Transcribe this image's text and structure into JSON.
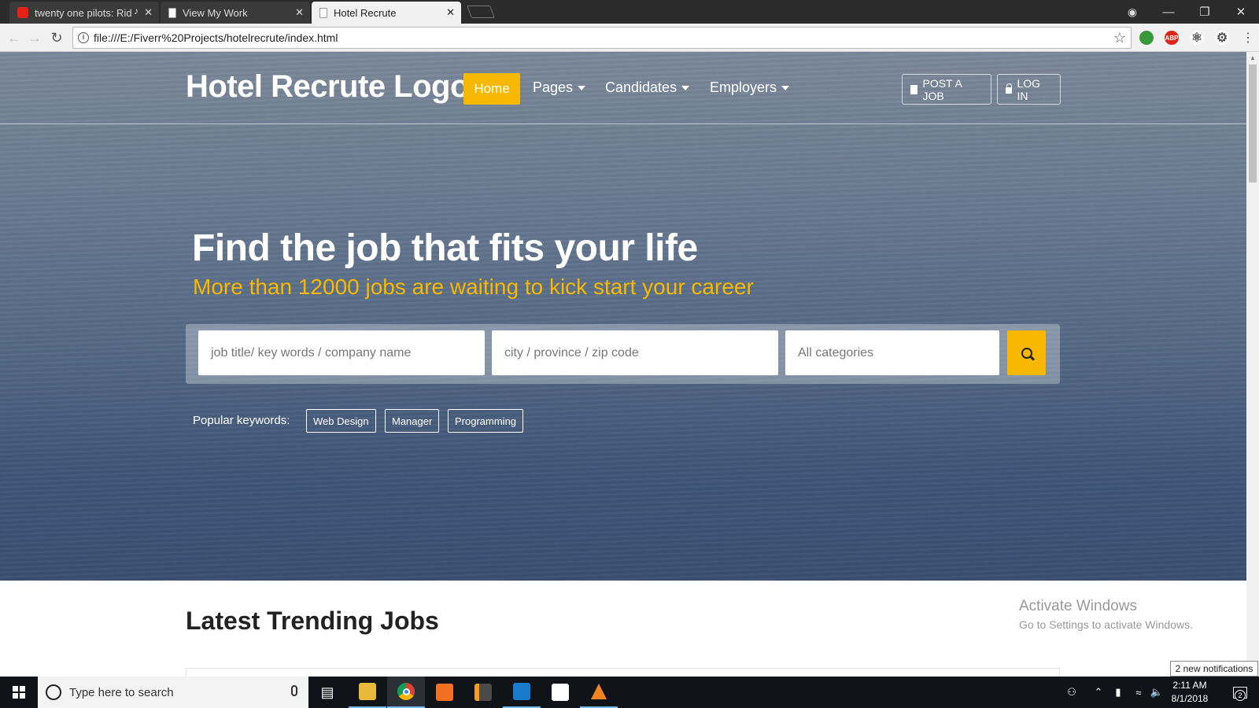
{
  "browser": {
    "tabs": [
      {
        "title": "twenty one pilots: Rid",
        "icon": "youtube-icon",
        "audio": true
      },
      {
        "title": "View My Work",
        "icon": "page-icon"
      },
      {
        "title": "Hotel Recrute",
        "icon": "page-icon",
        "active": true
      }
    ],
    "url": "file:///E:/Fiverr%20Projects/hotelrecrute/index.html",
    "extensions": [
      {
        "name": "chrome-color-ext",
        "color": "#3a9a3a"
      },
      {
        "name": "abp",
        "label": "ABP",
        "color": "#d9271c"
      },
      {
        "name": "react-devtools",
        "color": "#555555"
      },
      {
        "name": "settings-ext",
        "color": "#555555"
      }
    ]
  },
  "site": {
    "logo": "Hotel Recrute Logo",
    "nav": {
      "home": "Home",
      "pages": "Pages",
      "candidates": "Candidates",
      "employers": "Employers"
    },
    "post_job": "POST A JOB",
    "login": "LOG IN",
    "hero": {
      "title": "Find the job that fits your life",
      "subtitle": "More than 12000 jobs are waiting to kick start your career"
    },
    "search": {
      "keywords_placeholder": "job title/ key words / company name",
      "location_placeholder": "city / province / zip code",
      "category": "All categories"
    },
    "popular": {
      "label": "Popular keywords:",
      "keywords": [
        "Web Design",
        "Manager",
        "Programming"
      ]
    },
    "section_title": "Latest Trending Jobs",
    "accent_color": "#f9b800"
  },
  "windows": {
    "activate_title": "Activate Windows",
    "activate_sub": "Go to Settings to activate Windows.",
    "search_placeholder": "Type here to search",
    "time": "2:11 AM",
    "date": "8/1/2018",
    "notifications": "2 new notifications",
    "notification_count": "2"
  }
}
